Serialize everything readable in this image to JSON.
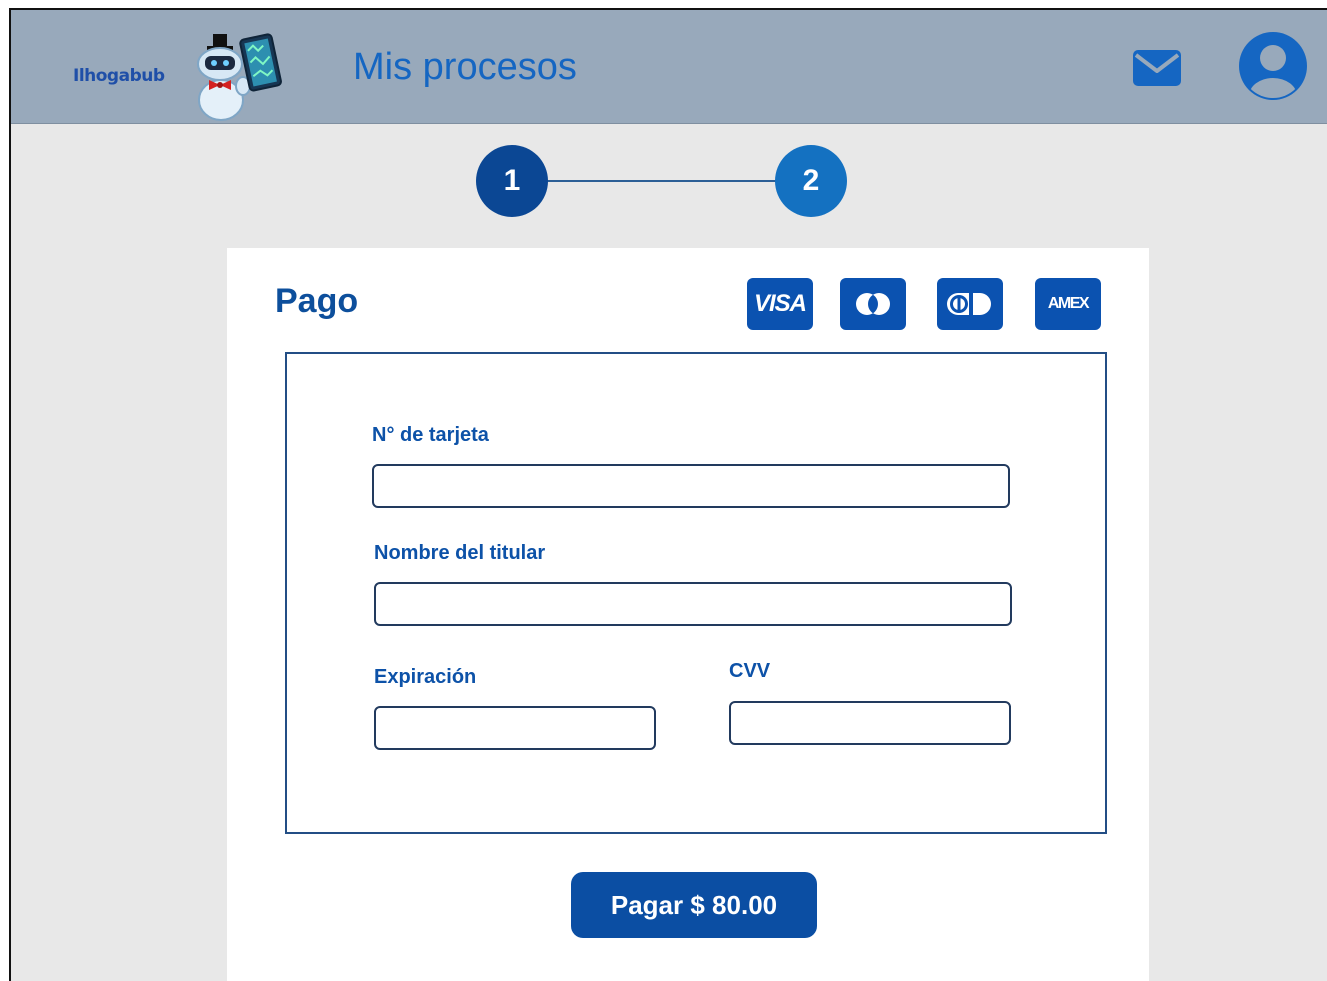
{
  "header": {
    "logo_text": "Ilhogabub",
    "title": "Mis procesos"
  },
  "stepper": {
    "steps": [
      "1",
      "2"
    ],
    "current": 2
  },
  "payment": {
    "title": "Pago",
    "card_brands": [
      "VISA",
      "Mastercard",
      "Diners",
      "AMEX"
    ],
    "visa_label": "VISA",
    "amex_label": "AMEX",
    "card_number_label": "N° de tarjeta",
    "card_number_value": "",
    "holder_label": "Nombre del titular",
    "holder_value": "",
    "expiry_label": "Expiración",
    "expiry_value": "",
    "cvv_label": "CVV",
    "cvv_value": "",
    "pay_button": "Pagar $ 80.00"
  },
  "colors": {
    "header_bg": "#98a9bb",
    "primary": "#0b4ea3",
    "accent": "#1471c1",
    "page_bg": "#e8e8e8"
  },
  "icons": {
    "mail": "mail-icon",
    "user": "user-icon"
  }
}
